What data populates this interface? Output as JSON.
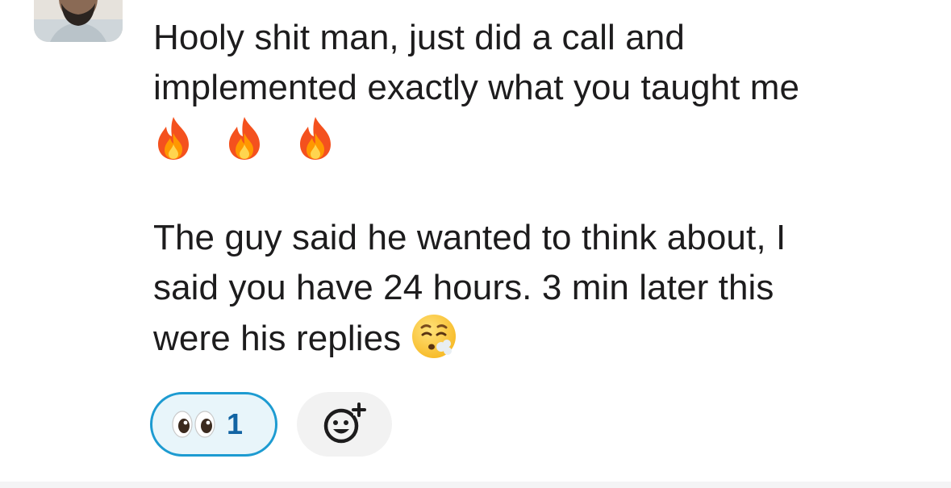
{
  "message": {
    "paragraph1": {
      "line1": "Hooly shit man, just did a call and",
      "line2": "implemented exactly what you taught me",
      "emojis": [
        "fire-emoji",
        "fire-emoji",
        "fire-emoji"
      ]
    },
    "paragraph2": {
      "line1": "The guy said he wanted to think about, I",
      "line2": "said you have 24 hours. 3 min later this",
      "line3": "were his replies",
      "trailing_emoji": "face-exhaling-emoji"
    }
  },
  "reactions": {
    "items": [
      {
        "icon": "eyes-emoji",
        "count": "1",
        "selected": true
      }
    ],
    "add_reaction_icon": "add-reaction-icon"
  },
  "colors": {
    "text": "#1d1c1d",
    "reaction_border": "#1d9bd1",
    "reaction_bg": "#e8f5fa",
    "reaction_count": "#1264a3",
    "add_reaction_bg": "#f2f2f2"
  }
}
